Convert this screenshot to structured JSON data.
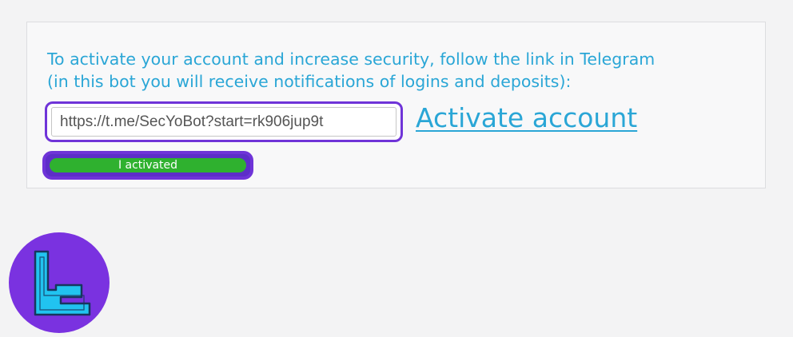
{
  "activation": {
    "instruction_line1": "To activate your account and increase security, follow the link in Telegram",
    "instruction_line2": "(in this bot you will receive notifications of logins and deposits):",
    "telegram_link_value": "https://t.me/SecYoBot?start=rk906jup9t",
    "activate_link_label": "Activate account",
    "activated_button_label": "I activated"
  },
  "logo": {
    "icon": "tradingfinder-logo-icon"
  },
  "colors": {
    "page_background": "#f3f3f4",
    "panel_background": "#f8f8f9",
    "text_accent": "#2aa6d6",
    "highlight_frame": "#6f34d8",
    "button_green": "#2fb12f",
    "logo_circle": "#7a32e0",
    "logo_mark": "#21c3f0"
  }
}
